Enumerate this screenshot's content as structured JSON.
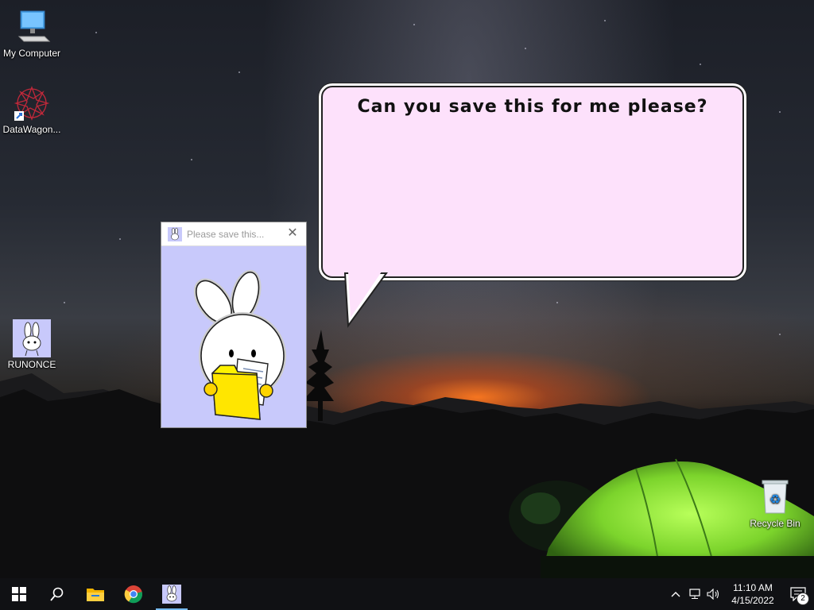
{
  "desktop": {
    "icons": [
      {
        "label": "My Computer",
        "icon": "computer-icon"
      },
      {
        "label": "DataWagon...",
        "icon": "datawagon-shortcut-icon"
      },
      {
        "label": "RUNONCE",
        "icon": "bunny-app-icon"
      },
      {
        "label": "Recycle Bin",
        "icon": "recycle-bin-icon"
      }
    ]
  },
  "bubble": {
    "text": "Can you save this for me please?"
  },
  "window": {
    "title": "Please save this...",
    "close_glyph": "✕"
  },
  "taskbar": {
    "items": [
      {
        "name": "start",
        "icon": "windows-start-icon"
      },
      {
        "name": "search",
        "icon": "search-icon"
      },
      {
        "name": "file-explorer",
        "icon": "folder-icon"
      },
      {
        "name": "chrome",
        "icon": "chrome-icon"
      },
      {
        "name": "bunny-app",
        "icon": "bunny-app-icon",
        "active": true
      }
    ],
    "tray": {
      "chevron": "^",
      "time": "11:10 AM",
      "date": "4/15/2022",
      "notification_count": "2"
    }
  },
  "colors": {
    "bubble_fill": "#fde1fb",
    "window_bg": "#c8c9fb",
    "taskbar": "#101114",
    "tent_green": "#8fe33a",
    "folder_yellow": "#fff200"
  }
}
